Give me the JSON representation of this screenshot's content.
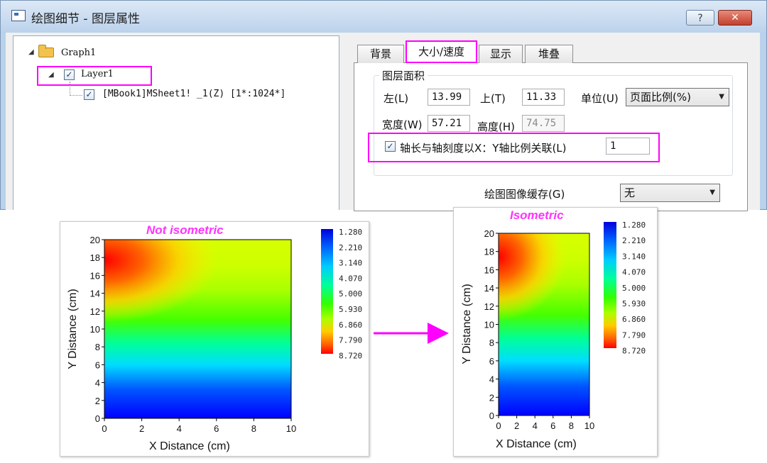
{
  "dialog": {
    "title": "绘图细节 - 图层属性",
    "help_label": "?",
    "close_label": "✕"
  },
  "tree": {
    "graph": {
      "label": "Graph1",
      "icon": "folder-icon"
    },
    "layer": {
      "label": "Layer1",
      "checked": true
    },
    "dataset": {
      "label": "[MBook1]MSheet1! _1(Z) [1*:1024*]",
      "checked": true
    }
  },
  "tabs": [
    {
      "label": "背景"
    },
    {
      "label": "大小/速度"
    },
    {
      "label": "显示"
    },
    {
      "label": "堆叠"
    }
  ],
  "layer_area": {
    "group_title": "图层面积",
    "left_label": "左(L)",
    "left_value": "13.99",
    "top_label": "上(T)",
    "top_value": "11.33",
    "unit_label": "单位(U)",
    "unit_value": "页面比例(%)",
    "width_label": "宽度(W)",
    "width_value": "57.21",
    "height_label": "高度(H)",
    "height_value": "74.75",
    "link_label": "轴长与轴刻度以X：Y轴比例关联(L)",
    "link_checked": true,
    "link_value": "1"
  },
  "cache": {
    "label": "绘图图像缓存(G)",
    "value": "无"
  },
  "colors": {
    "highlight": "#ff00ff",
    "arrow": "#ff00ff",
    "plot_title": "#ff33ff"
  },
  "chart_data": [
    {
      "type": "heatmap",
      "title": "Not isometric",
      "xlabel": "X Distance (cm)",
      "ylabel": "Y Distance (cm)",
      "xlim": [
        0,
        10
      ],
      "ylim": [
        0,
        20
      ],
      "x_ticks": [
        "0",
        "2",
        "4",
        "6",
        "8",
        "10"
      ],
      "y_ticks": [
        "0",
        "2",
        "4",
        "6",
        "8",
        "10",
        "12",
        "14",
        "16",
        "18",
        "20"
      ],
      "colorbar": {
        "labels": [
          "1.280",
          "2.210",
          "3.140",
          "4.070",
          "5.000",
          "5.930",
          "6.860",
          "7.790",
          "8.720"
        ],
        "colors": [
          "#0000ff",
          "#0066ff",
          "#00ccff",
          "#00ff99",
          "#33ff00",
          "#aaff00",
          "#ffcc00",
          "#ff6600",
          "#ff0000"
        ]
      },
      "peak": {
        "x": 0,
        "y": 17,
        "value": 8.72
      },
      "legend_position": "right"
    },
    {
      "type": "heatmap",
      "title": "Isometric",
      "xlabel": "X Distance (cm)",
      "ylabel": "Y Distance (cm)",
      "xlim": [
        0,
        10
      ],
      "ylim": [
        0,
        20
      ],
      "x_ticks": [
        "0",
        "2",
        "4",
        "6",
        "8",
        "10"
      ],
      "y_ticks": [
        "0",
        "2",
        "4",
        "6",
        "8",
        "10",
        "12",
        "14",
        "16",
        "18",
        "20"
      ],
      "colorbar": {
        "labels": [
          "1.280",
          "2.210",
          "3.140",
          "4.070",
          "5.000",
          "5.930",
          "6.860",
          "7.790",
          "8.720"
        ],
        "colors": [
          "#0000ff",
          "#0066ff",
          "#00ccff",
          "#00ff99",
          "#33ff00",
          "#aaff00",
          "#ffcc00",
          "#ff6600",
          "#ff0000"
        ]
      },
      "peak": {
        "x": 0,
        "y": 17,
        "value": 8.72
      },
      "legend_position": "right"
    }
  ]
}
